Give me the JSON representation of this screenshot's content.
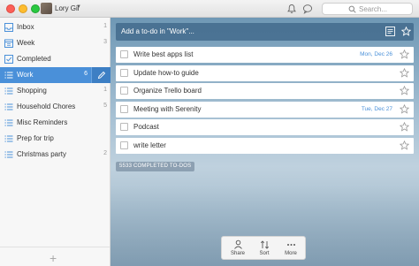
{
  "window": {
    "user_name": "Lory Gil",
    "search_placeholder": "Search..."
  },
  "sidebar": {
    "items": [
      {
        "label": "Inbox",
        "count": "1",
        "icon": "inbox-icon"
      },
      {
        "label": "Week",
        "count": "3",
        "icon": "calendar-icon"
      },
      {
        "label": "Completed",
        "count": "",
        "icon": "checkbox-icon"
      },
      {
        "label": "Work",
        "count": "6",
        "icon": "list-icon",
        "active": true
      },
      {
        "label": "Shopping",
        "count": "1",
        "icon": "list-icon"
      },
      {
        "label": "Household Chores",
        "count": "5",
        "icon": "list-icon"
      },
      {
        "label": "Misc Reminders",
        "count": "",
        "icon": "list-icon"
      },
      {
        "label": "Prep for trip",
        "count": "",
        "icon": "list-icon"
      },
      {
        "label": "Christmas party",
        "count": "2",
        "icon": "list-icon"
      }
    ],
    "add_label": "+"
  },
  "main": {
    "add_placeholder": "Add a to-do in \"Work\"...",
    "tasks": [
      {
        "title": "Write best apps list",
        "due": "Mon, Dec 26"
      },
      {
        "title": "Update how-to guide",
        "due": ""
      },
      {
        "title": "Organize Trello board",
        "due": ""
      },
      {
        "title": "Meeting with Serenity",
        "due": "Tue, Dec 27"
      },
      {
        "title": "Podcast",
        "due": ""
      },
      {
        "title": "write letter",
        "due": ""
      }
    ],
    "completed_label": "5533 COMPLETED TO-DOS"
  },
  "toolbar": {
    "share": "Share",
    "sort": "Sort",
    "more": "More"
  },
  "colors": {
    "accent": "#4a90d9",
    "add_bar": "#3c6487"
  }
}
